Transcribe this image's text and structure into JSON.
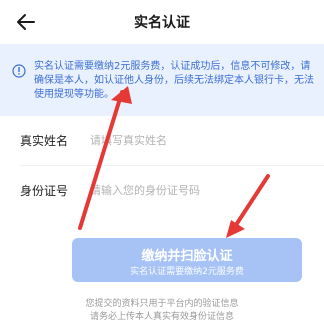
{
  "header": {
    "title": "实名认证",
    "back_icon": "arrow-left-icon"
  },
  "notice": {
    "icon": "info-circle-icon",
    "text": "实名认证需要缴纳2元服务费，认证成功后，信息不可修改，请确保是本人，如认证他人身份，后续无法绑定本人银行卡，无法使用提现等功能。"
  },
  "form": {
    "name_label": "真实姓名",
    "name_placeholder": "请填写真实姓名",
    "id_label": "身份证号",
    "id_placeholder": "请输入您的身份证号码"
  },
  "submit": {
    "label": "缴纳并扫脸认证",
    "sublabel": "实名认证需要缴纳2元服务费"
  },
  "footer": {
    "line1": "您提交的资料只用于平台内的验证信息",
    "line2": "请务必上传本人真实有效身份证信息"
  },
  "colors": {
    "accent": "#3b6fd4",
    "notice_bg": "#eaf1fe",
    "button_bg": "#a7c3f6",
    "annotation_arrow": "#e53935"
  }
}
